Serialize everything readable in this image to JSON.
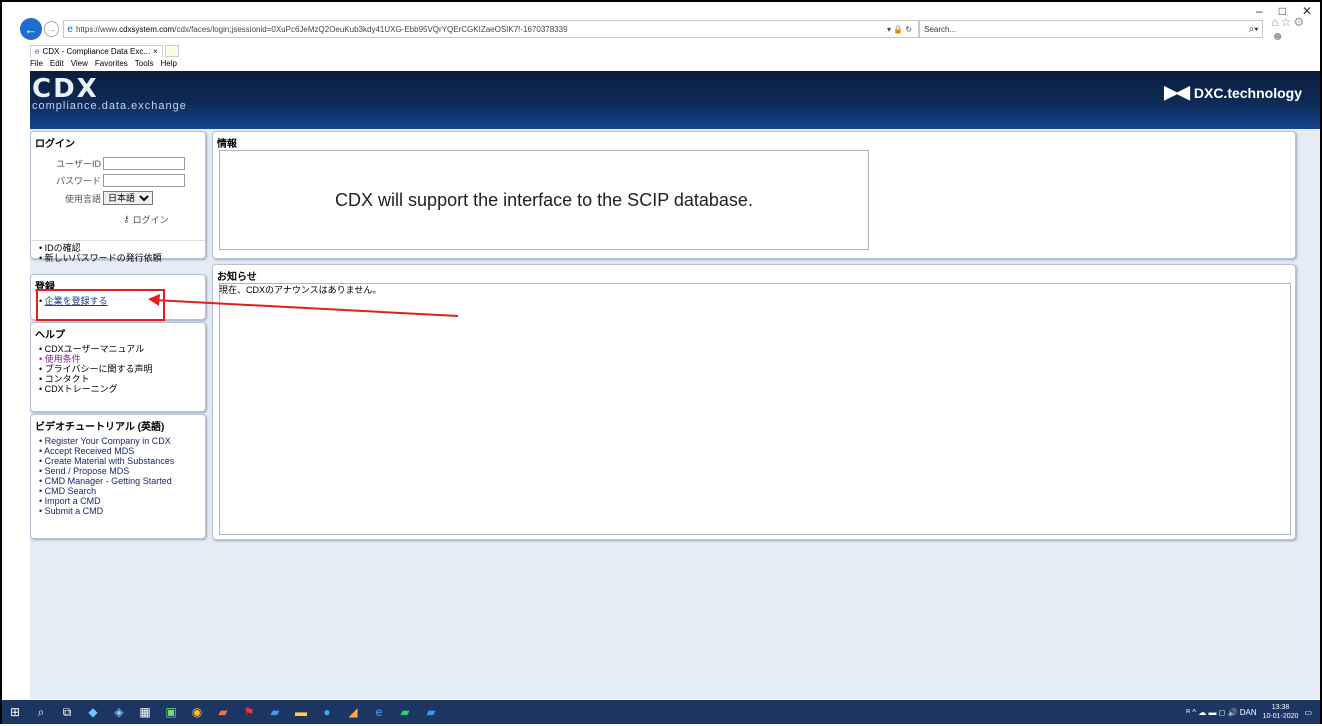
{
  "window": {
    "minimize": "–",
    "maximize": "□",
    "close": "✕"
  },
  "browser": {
    "url_prefix": "https://www.",
    "url_domain": "cdxsystem.com",
    "url_rest": "/cdx/faces/login;jsessionid=0XuPc6JeMzQ2OeuKub3kdy41UXG-Ebb95VQrYQErCGKIZaeOSIK7!-1670378339",
    "url_tools": "▾ 🔒 ↻",
    "search_placeholder": "Search...",
    "search_go": "⌕▾",
    "toolbar_icons": "⌂☆⚙☻",
    "tab_title": "CDX - Compliance Data Exc...",
    "tab_close": "×",
    "menu": [
      "File",
      "Edit",
      "View",
      "Favorites",
      "Tools",
      "Help"
    ]
  },
  "banner": {
    "cdx_logo": "CDX",
    "cdx_sub": "compliance.data.exchange",
    "dxc_mark": "▶◀",
    "dxc_text": "DXC.technology"
  },
  "login": {
    "title": "ログイン",
    "user_id_label": "ユーザーID",
    "password_label": "パスワード",
    "language_label": "使用言語",
    "language_value": "日本語",
    "login_button": "ログイン",
    "links": [
      "IDの確認",
      "新しいパスワードの発行依頼"
    ]
  },
  "register": {
    "title": "登録",
    "link": "企業を登録する"
  },
  "help": {
    "title": "ヘルプ",
    "links": [
      "CDXユーザーマニュアル",
      "使用条件",
      "プライバシーに関する声明",
      "コンタクト",
      "CDXトレーニング"
    ]
  },
  "video": {
    "title": "ビデオチュートリアル (英語)",
    "links": [
      "Register Your Company in CDX",
      "Accept Received MDS",
      "Create Material with Substances",
      "Send / Propose MDS",
      "CMD Manager - Getting Started",
      "CMD Search",
      "Import a CMD",
      "Submit a CMD"
    ]
  },
  "info": {
    "title": "情報",
    "message": "CDX will support the interface to the SCIP database."
  },
  "notice": {
    "title": "お知らせ",
    "text": "現在、CDXのアナウンスはありません。"
  },
  "taskbar": {
    "icons": [
      "windows-icon",
      "search-icon",
      "task-view-icon",
      "app-icon",
      "app-icon",
      "calculator-icon",
      "app-icon",
      "chrome-icon",
      "powerpoint-icon",
      "acrobat-icon",
      "word-icon",
      "file-explorer-icon",
      "skype-icon",
      "app-icon",
      "internet-explorer-icon",
      "excel-icon",
      "outlook-icon"
    ],
    "tray": "ᴿ ^ ☁ ▬ ◻ 🔊 DAN",
    "time": "13:38",
    "date": "10-01-2020"
  }
}
